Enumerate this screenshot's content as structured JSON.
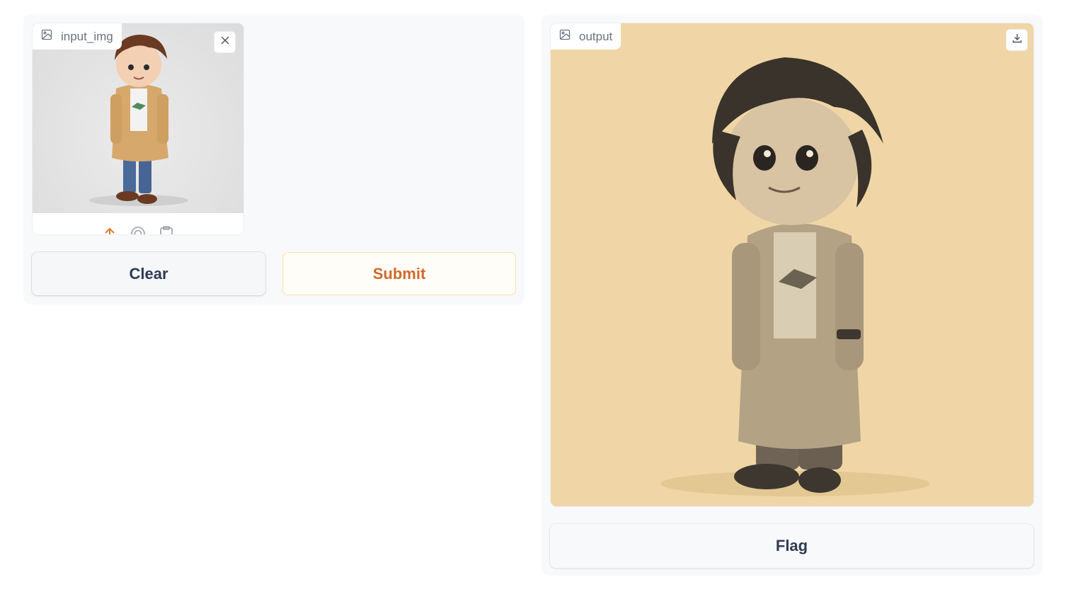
{
  "input": {
    "label": "input_img",
    "icon": "image-icon",
    "clear_icon": "close-icon",
    "sources": [
      "upload-icon",
      "webcam-icon",
      "clipboard-icon"
    ]
  },
  "output": {
    "label": "output",
    "icon": "image-icon",
    "download_icon": "download-icon"
  },
  "buttons": {
    "clear": "Clear",
    "submit": "Submit",
    "flag": "Flag"
  },
  "colors": {
    "accent": "#d2692c",
    "submit_border": "#fbe0a7",
    "output_background": "#f0d6a6",
    "text_dark": "#2f3b52",
    "label_gray": "#6b7280"
  }
}
